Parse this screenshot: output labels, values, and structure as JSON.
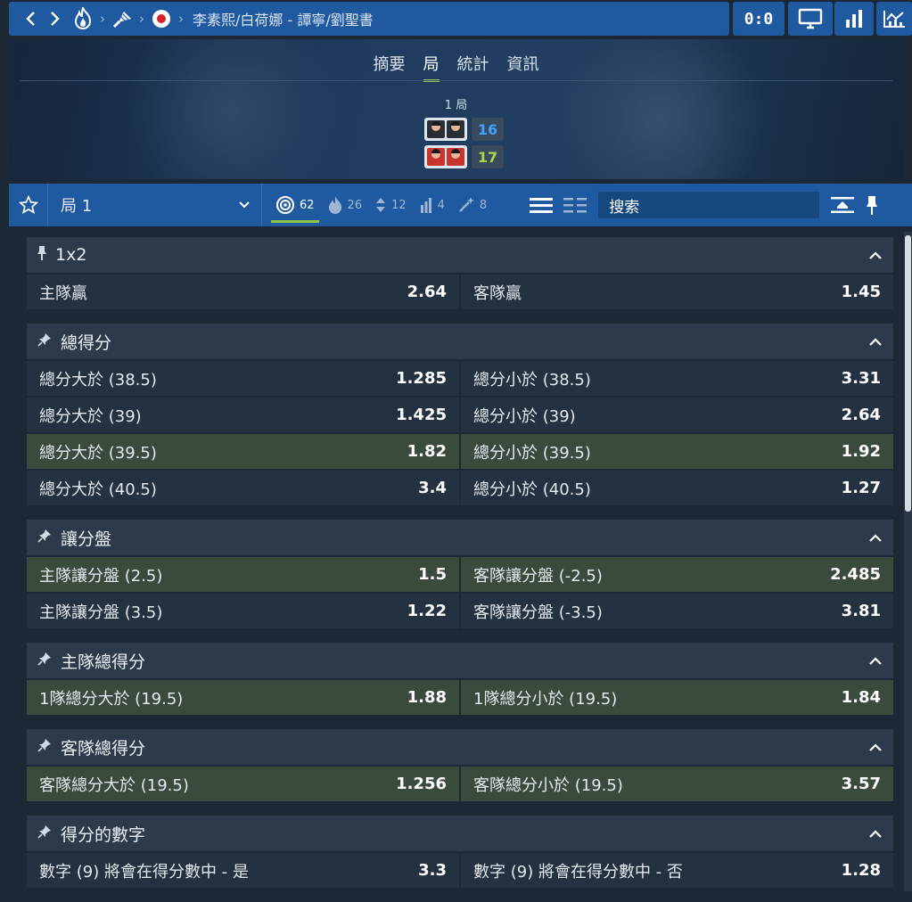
{
  "topbar": {
    "breadcrumb": "李素熙/白荷娜 - 譚寧/劉聖書",
    "score": "0:0"
  },
  "header": {
    "tabs": [
      "摘要",
      "局",
      "統計",
      "資訊"
    ],
    "active_tab": "局",
    "set_label": "1 局",
    "home_points": "16",
    "away_points": "17",
    "home_points_color": "#3ea3ff",
    "away_points_color": "#a8d64a"
  },
  "toolbar": {
    "selected_period": "局 1",
    "filters": [
      {
        "icon": "target-icon",
        "count": "62"
      },
      {
        "icon": "fire-icon",
        "count": "26"
      },
      {
        "icon": "updown-icon",
        "count": "12"
      },
      {
        "icon": "ladder-icon",
        "count": "4"
      },
      {
        "icon": "wand-icon",
        "count": "8"
      }
    ],
    "search_placeholder": "搜索"
  },
  "markets": [
    {
      "title": "1x2",
      "pin": "pin-icon",
      "rows": [
        [
          {
            "label": "主隊贏",
            "odd": "2.64",
            "hl": false
          },
          {
            "label": "客隊贏",
            "odd": "1.45",
            "hl": false
          }
        ]
      ]
    },
    {
      "title": "總得分",
      "pin": "pushpin-icon",
      "rows": [
        [
          {
            "label": "總分大於 (38.5)",
            "odd": "1.285",
            "hl": false
          },
          {
            "label": "總分小於 (38.5)",
            "odd": "3.31",
            "hl": false
          }
        ],
        [
          {
            "label": "總分大於 (39)",
            "odd": "1.425",
            "hl": false
          },
          {
            "label": "總分小於 (39)",
            "odd": "2.64",
            "hl": false
          }
        ],
        [
          {
            "label": "總分大於 (39.5)",
            "odd": "1.82",
            "hl": true
          },
          {
            "label": "總分小於 (39.5)",
            "odd": "1.92",
            "hl": true
          }
        ],
        [
          {
            "label": "總分大於 (40.5)",
            "odd": "3.4",
            "hl": false
          },
          {
            "label": "總分小於 (40.5)",
            "odd": "1.27",
            "hl": false
          }
        ]
      ]
    },
    {
      "title": "讓分盤",
      "pin": "pushpin-icon",
      "rows": [
        [
          {
            "label": "主隊讓分盤 (2.5)",
            "odd": "1.5",
            "hl": true
          },
          {
            "label": "客隊讓分盤 (-2.5)",
            "odd": "2.485",
            "hl": true
          }
        ],
        [
          {
            "label": "主隊讓分盤 (3.5)",
            "odd": "1.22",
            "hl": false
          },
          {
            "label": "客隊讓分盤 (-3.5)",
            "odd": "3.81",
            "hl": false
          }
        ]
      ]
    },
    {
      "title": "主隊總得分",
      "pin": "pushpin-icon",
      "rows": [
        [
          {
            "label": "1隊總分大於 (19.5)",
            "odd": "1.88",
            "hl": true
          },
          {
            "label": "1隊總分小於 (19.5)",
            "odd": "1.84",
            "hl": true
          }
        ]
      ]
    },
    {
      "title": "客隊總得分",
      "pin": "pushpin-icon",
      "rows": [
        [
          {
            "label": "客隊總分大於 (19.5)",
            "odd": "1.256",
            "hl": true
          },
          {
            "label": "客隊總分小於 (19.5)",
            "odd": "3.57",
            "hl": true
          }
        ]
      ]
    },
    {
      "title": "得分的數字",
      "pin": "pushpin-icon",
      "rows": [
        [
          {
            "label": "數字 (9) 將會在得分數中 - 是",
            "odd": "3.3",
            "hl": false
          },
          {
            "label": "數字 (9) 將會在得分數中 - 否",
            "odd": "1.28",
            "hl": false
          }
        ]
      ]
    }
  ]
}
